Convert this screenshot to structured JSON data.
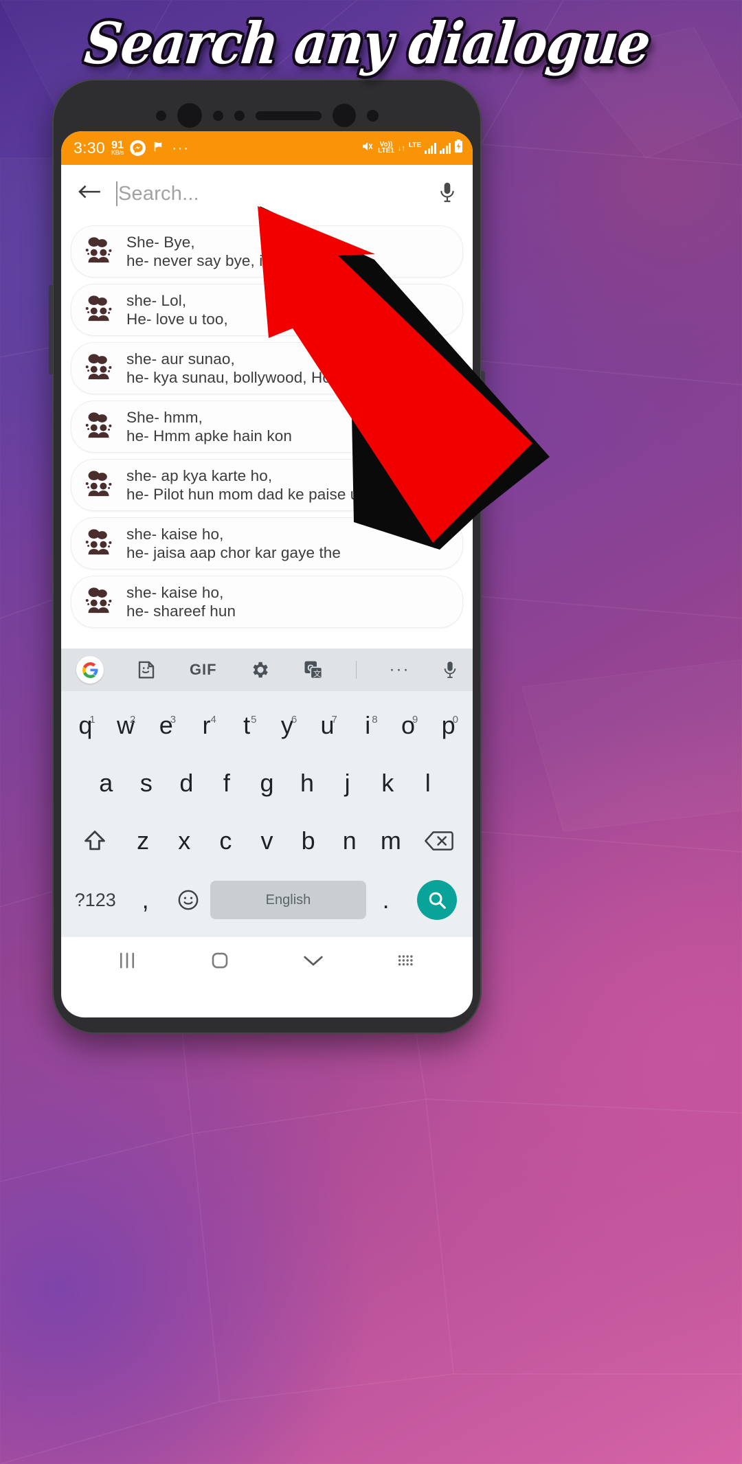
{
  "promo": {
    "headline": "Search any dialogue",
    "accent_red": "#f20000",
    "accent_orange": "#f89406",
    "teal": "#0aa39a"
  },
  "statusbar": {
    "time": "3:30",
    "net_speed_value": "91",
    "net_speed_unit": "KB/s",
    "messenger_icon": "messenger-icon",
    "flag_icon": "flag-icon",
    "more_dots": "···",
    "mute_icon": "mute-icon",
    "volte_line1": "Vo))",
    "volte_line2": "LTE1",
    "data_arrows": "↓↑",
    "lte_label": "LTE",
    "signal_icon": "signal-bars-icon",
    "battery_icon": "battery-charging-icon"
  },
  "search": {
    "back_icon": "back-arrow-icon",
    "placeholder": "Search...",
    "value": "",
    "mic_icon": "microphone-icon"
  },
  "list": {
    "row_icon": "group-chat-icon",
    "items": [
      {
        "line1": "She- Bye,",
        "line2": "he- never say bye, ",
        "line2_tail": "in rahi pyar"
      },
      {
        "line1": "she- Lol,",
        "line2": "He- love u too,"
      },
      {
        "line1": "she- aur sunao,",
        "line2": "he- kya sunau, bollywood, Ho"
      },
      {
        "line1": "She- hmm,",
        "line2": "he- Hmm apke hain kon"
      },
      {
        "line1": "she- ap kya karte ho,",
        "line2": "he- Pilot hun mom dad ke paise udata h"
      },
      {
        "line1": "she- kaise ho,",
        "line2": "he- jaisa aap chor kar gaye the"
      },
      {
        "line1": "she- kaise ho,",
        "line2": "he- shareef hun"
      }
    ]
  },
  "keyboard": {
    "toolbar": [
      {
        "name": "google-logo-icon",
        "label": "G"
      },
      {
        "name": "sticker-icon",
        "label": ""
      },
      {
        "name": "gif-icon",
        "label": "GIF"
      },
      {
        "name": "settings-gear-icon",
        "label": ""
      },
      {
        "name": "translate-icon",
        "label": ""
      },
      {
        "name": "toolbar-divider",
        "label": ""
      },
      {
        "name": "more-options-icon",
        "label": "···"
      },
      {
        "name": "voice-input-icon",
        "label": ""
      }
    ],
    "row1": [
      {
        "key": "q",
        "num": "1"
      },
      {
        "key": "w",
        "num": "2"
      },
      {
        "key": "e",
        "num": "3"
      },
      {
        "key": "r",
        "num": "4"
      },
      {
        "key": "t",
        "num": "5"
      },
      {
        "key": "y",
        "num": "6"
      },
      {
        "key": "u",
        "num": "7"
      },
      {
        "key": "i",
        "num": "8"
      },
      {
        "key": "o",
        "num": "9"
      },
      {
        "key": "p",
        "num": "0"
      }
    ],
    "row2": [
      "a",
      "s",
      "d",
      "f",
      "g",
      "h",
      "j",
      "k",
      "l"
    ],
    "row3": [
      "z",
      "x",
      "c",
      "v",
      "b",
      "n",
      "m"
    ],
    "shift_icon": "shift-key-icon",
    "backspace_icon": "backspace-key-icon",
    "symbols_label": "?123",
    "comma_label": ",",
    "emoji_icon": "emoji-key-icon",
    "space_label": "English",
    "period_label": ".",
    "enter_icon": "search-key-icon"
  },
  "navbar": {
    "recents_icon": "recent-apps-icon",
    "home_icon": "home-icon",
    "hide_keyboard_icon": "hide-keyboard-icon",
    "keyboard_switch_icon": "keyboard-switch-icon"
  }
}
